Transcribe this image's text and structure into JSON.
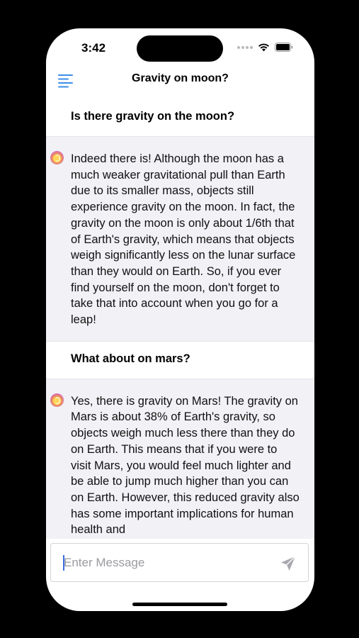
{
  "status_bar": {
    "time": "3:42"
  },
  "nav": {
    "title": "Gravity on moon?"
  },
  "messages": [
    {
      "role": "user",
      "text": "Is there gravity on the moon?"
    },
    {
      "role": "assistant",
      "text": "Indeed there is! Although the moon has a much weaker gravitational pull than Earth due to its smaller mass, objects still experience gravity on the moon. In fact, the gravity on the moon is only about 1/6th that of Earth's gravity, which means that objects weigh significantly less on the lunar surface than they would on Earth. So, if you ever find yourself on the moon, don't forget to take that into account when you go for a leap!"
    },
    {
      "role": "user",
      "text": "What about on mars?"
    },
    {
      "role": "assistant",
      "text": "Yes, there is gravity on Mars! The gravity on Mars is about 38% of Earth's gravity, so objects weigh much less there than they do on Earth. This means that if you were to visit Mars, you would feel much lighter and be able to jump much higher than you can on Earth. However, this reduced gravity also has some important implications for human health and"
    }
  ],
  "composer": {
    "placeholder": "Enter Message"
  },
  "colors": {
    "accent": "#3b8ee8",
    "bot_bubble": "#f1f1f6",
    "send_icon": "#a8a8ae"
  },
  "icons": {
    "menu": "menu-icon",
    "send": "send-icon",
    "wifi": "wifi-icon",
    "battery": "battery-icon",
    "bot": "bot-avatar-icon"
  }
}
